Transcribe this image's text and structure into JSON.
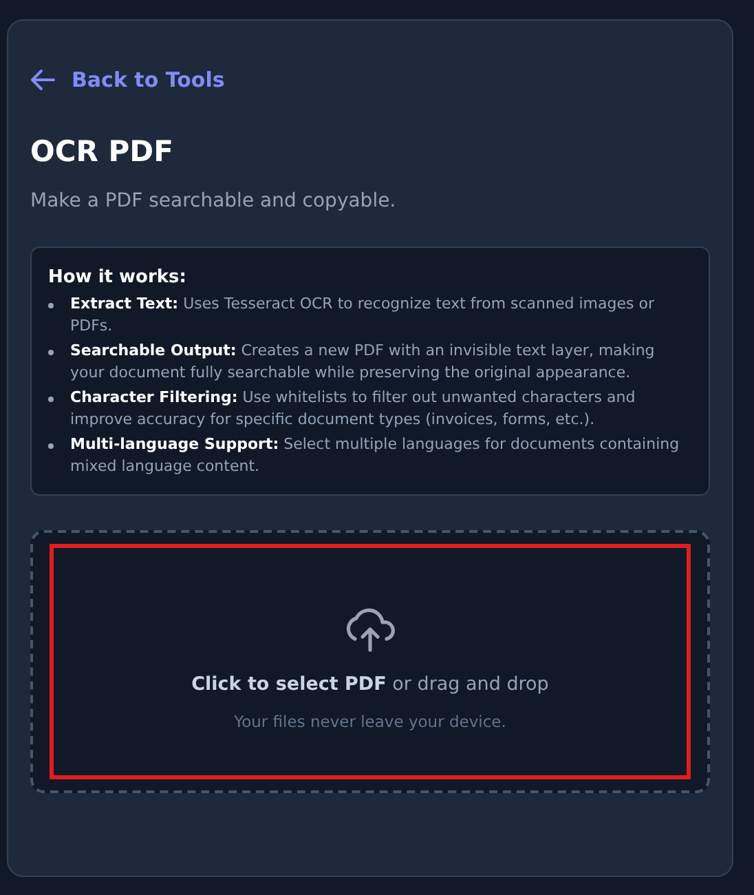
{
  "back_link": {
    "label": "Back to Tools"
  },
  "title": "OCR PDF",
  "subtitle": "Make a PDF searchable and copyable.",
  "info": {
    "heading": "How it works:",
    "items": [
      "**Extract Text:** Uses Tesseract OCR to recognize text from scanned images or PDFs.",
      "**Searchable Output:** Creates a new PDF with an invisible text layer, making your document fully searchable while preserving the original appearance.",
      "**Character Filtering:** Use whitelists to filter out unwanted characters and improve accuracy for specific document types (invoices, forms, etc.).",
      "**Multi-language Support:** Select multiple languages for documents containing mixed language content."
    ]
  },
  "dropzone": {
    "prompt": "**Click to select PDF** or drag and drop",
    "note": "Your files never leave your device.",
    "highlighted": true
  }
}
